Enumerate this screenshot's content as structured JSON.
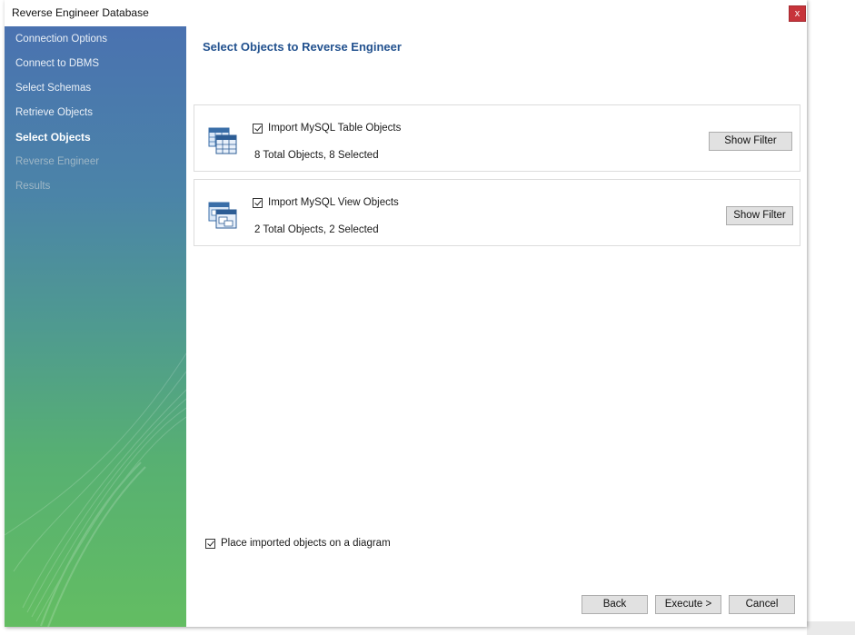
{
  "window": {
    "title": "Reverse Engineer Database",
    "close_label": "x"
  },
  "sidebar": {
    "steps": [
      {
        "label": "Connection Options",
        "state": "done"
      },
      {
        "label": "Connect to DBMS",
        "state": "done"
      },
      {
        "label": "Select Schemas",
        "state": "done"
      },
      {
        "label": "Retrieve Objects",
        "state": "done"
      },
      {
        "label": "Select Objects",
        "state": "active"
      },
      {
        "label": "Reverse Engineer",
        "state": "pending"
      },
      {
        "label": "Results",
        "state": "pending"
      }
    ]
  },
  "main": {
    "heading": "Select Objects to Reverse Engineer",
    "groups": [
      {
        "icon": "table-objects-icon",
        "checkbox_label": "Import MySQL Table Objects",
        "checked": true,
        "summary": "8 Total Objects, 8 Selected",
        "filter_button": "Show Filter"
      },
      {
        "icon": "view-objects-icon",
        "checkbox_label": "Import MySQL View Objects",
        "checked": true,
        "summary": "2 Total Objects, 2 Selected",
        "filter_button": "Show Filter"
      }
    ],
    "place_on_diagram": {
      "label": "Place imported objects on a diagram",
      "checked": true
    }
  },
  "footer": {
    "back": "Back",
    "execute": "Execute >",
    "cancel": "Cancel"
  },
  "colors": {
    "heading": "#23528f",
    "close": "#c7343b",
    "sidebar_top": "#4a72b0",
    "sidebar_bottom": "#63bd62"
  }
}
